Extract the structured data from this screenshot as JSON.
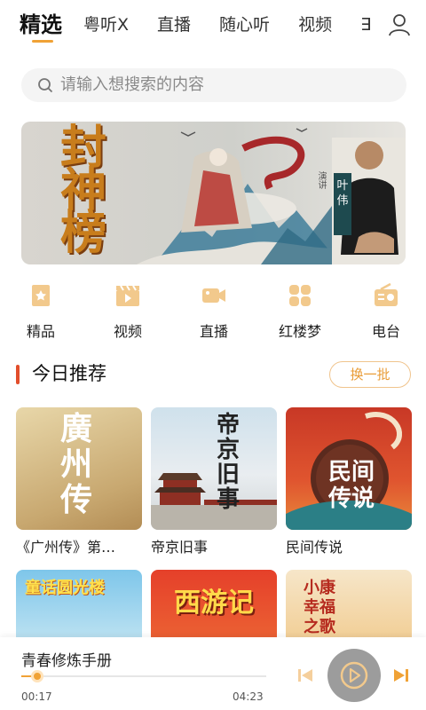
{
  "tabs": [
    {
      "label": "精选",
      "active": true
    },
    {
      "label": "粤听X",
      "active": false
    },
    {
      "label": "直播",
      "active": false
    },
    {
      "label": "随心听",
      "active": false
    },
    {
      "label": "视频",
      "active": false
    },
    {
      "label": "∃",
      "active": false
    }
  ],
  "header": {
    "user_icon": "user-icon"
  },
  "search": {
    "placeholder": "请输入想搜索的内容",
    "icon": "search-icon"
  },
  "banner": {
    "title": "封神榜",
    "tag": "叶伟",
    "caption": "演讲"
  },
  "categories": [
    {
      "label": "精品",
      "icon": "star-bookmark-icon"
    },
    {
      "label": "视频",
      "icon": "video-clapper-icon"
    },
    {
      "label": "直播",
      "icon": "video-camera-icon"
    },
    {
      "label": "红楼梦",
      "icon": "grid-apps-icon"
    },
    {
      "label": "电台",
      "icon": "radio-icon"
    }
  ],
  "section": {
    "title": "今日推荐",
    "refresh_label": "换一批"
  },
  "cards": [
    {
      "title": "《广州传》第…",
      "cover_text": "廣州传"
    },
    {
      "title": "帝京旧事",
      "cover_text": "帝京旧事"
    },
    {
      "title": "民间传说",
      "cover_text": "民间传说"
    },
    {
      "title": "",
      "cover_text": "童话圆光楼"
    },
    {
      "title": "",
      "cover_text": "西游记"
    },
    {
      "title": "",
      "cover_text": "小康幸福之歌"
    }
  ],
  "player": {
    "title": "青春修炼手册",
    "current_time": "00:17",
    "total_time": "04:23",
    "progress": 0.065
  },
  "colors": {
    "accent": "#f0a236",
    "section_bar": "#e24e2b",
    "play_button": "#9c9c9c"
  }
}
